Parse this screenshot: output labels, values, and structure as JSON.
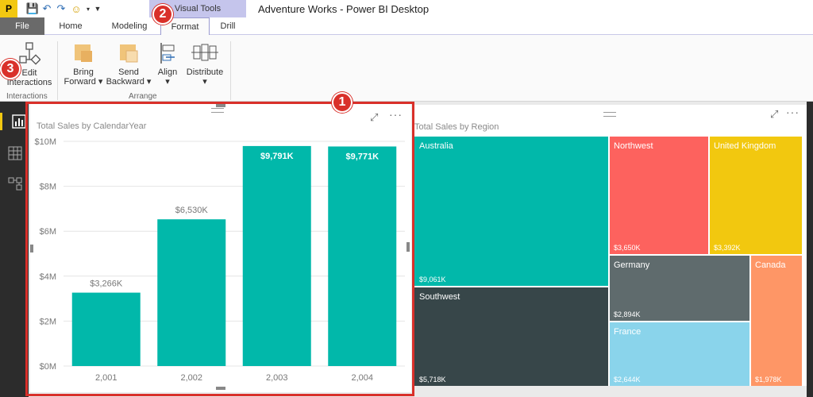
{
  "app": {
    "window_title": "Adventure Works - Power BI Desktop",
    "context_tab_group": "Visual Tools",
    "logo_text": "P"
  },
  "tabs": [
    "File",
    "Home",
    "Modeling",
    "Format",
    "Drill"
  ],
  "ribbon": {
    "edit_interactions_line1": "Edit",
    "edit_interactions_line2": "Interactions",
    "bring_forward_line1": "Bring",
    "bring_forward_line2": "Forward",
    "send_backward_line1": "Send",
    "send_backward_line2": "Backward",
    "align": "Align",
    "distribute": "Distribute",
    "group_interactions": "Interactions",
    "group_arrange": "Arrange"
  },
  "callouts": [
    "1",
    "2",
    "3"
  ],
  "bar_visual": {
    "title": "Total Sales by CalendarYear",
    "icons": [
      "focus-mode-icon",
      "more-options-icon"
    ]
  },
  "treemap_visual": {
    "title": "Total Sales by Region",
    "tiles": [
      {
        "name": "Australia",
        "value": "$9,061K",
        "color": "#01b8aa"
      },
      {
        "name": "Southwest",
        "value": "$5,718K",
        "color": "#374649"
      },
      {
        "name": "Northwest",
        "value": "$3,650K",
        "color": "#fd625e"
      },
      {
        "name": "United Kingdom",
        "value": "$3,392K",
        "color": "#f2c80f"
      },
      {
        "name": "Germany",
        "value": "$2,894K",
        "color": "#5f6b6d"
      },
      {
        "name": "France",
        "value": "$2,644K",
        "color": "#8ad4eb"
      },
      {
        "name": "Canada",
        "value": "$1,978K",
        "color": "#fe9666"
      }
    ]
  },
  "chart_data": {
    "type": "bar",
    "title": "Total Sales by CalendarYear",
    "categories": [
      "2,001",
      "2,002",
      "2,003",
      "2,004"
    ],
    "values": [
      3266,
      6530,
      9791,
      9771
    ],
    "value_labels": [
      "$3,266K",
      "$6,530K",
      "$9,791K",
      "$9,771K"
    ],
    "y_ticks": [
      "$0M",
      "$2M",
      "$4M",
      "$6M",
      "$8M",
      "$10M"
    ],
    "ylim": [
      0,
      10000
    ],
    "bar_color": "#01b8aa",
    "grid": true
  }
}
